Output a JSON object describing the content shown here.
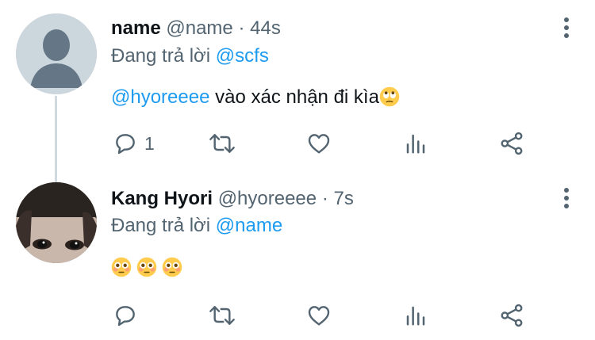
{
  "tweets": [
    {
      "display_name": "name",
      "handle": "@name",
      "separator": "·",
      "time": "44s",
      "reply_prefix": "Đang trả lời",
      "reply_to": "@scfs",
      "mention": "@hyoreeee",
      "text": "vào xác nhận đi kìa",
      "emoji": "face-with-rolling-eyes",
      "actions": {
        "reply_count": "1",
        "retweet_count": "",
        "like_count": ""
      }
    },
    {
      "display_name": "Kang Hyori",
      "handle": "@hyoreeee",
      "separator": "·",
      "time": "7s",
      "reply_prefix": "Đang trả lời",
      "reply_to": "@name",
      "emojis": [
        "flushed-face",
        "flushed-face",
        "flushed-face"
      ],
      "actions": {
        "reply_count": "",
        "retweet_count": "",
        "like_count": ""
      }
    }
  ],
  "colors": {
    "link": "#1d9bf0",
    "secondary_text": "#536471",
    "thread_line": "#cfd9de",
    "avatar_placeholder": "#ccd6dd"
  },
  "icons": {
    "reply": "speech-bubble-icon",
    "retweet": "retweet-icon",
    "like": "heart-icon",
    "analytics": "bar-chart-icon",
    "share": "share-icon",
    "more": "vertical-ellipsis-icon"
  }
}
